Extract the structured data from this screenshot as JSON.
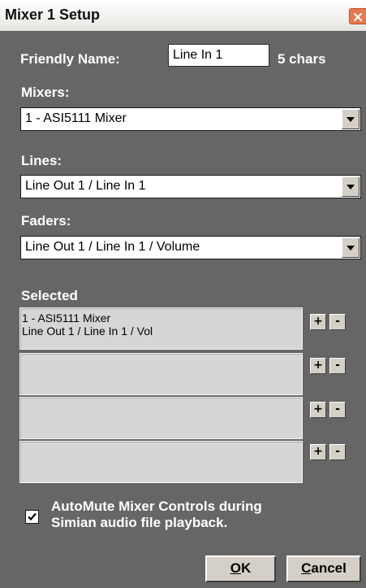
{
  "window": {
    "title": "Mixer 1 Setup",
    "close_icon": "close-icon"
  },
  "friendly_name": {
    "label": "Friendly Name:",
    "value": "Line In 1",
    "char_count": "5 chars"
  },
  "mixers": {
    "label": "Mixers:",
    "selected": "1 - ASI5111 Mixer"
  },
  "lines": {
    "label": "Lines:",
    "selected": "Line Out 1 / Line In 1"
  },
  "faders": {
    "label": "Faders:",
    "selected": "Line Out 1 / Line In 1 / Volume"
  },
  "selected": {
    "label": "Selected",
    "slots": [
      {
        "line1": "1 - ASI5111 Mixer",
        "line2": "Line Out 1 / Line In 1 / Vol",
        "plus": "+",
        "minus": "-"
      },
      {
        "line1": "",
        "line2": "",
        "plus": "+",
        "minus": "-"
      },
      {
        "line1": "",
        "line2": "",
        "plus": "+",
        "minus": "-"
      },
      {
        "line1": "",
        "line2": "",
        "plus": "+",
        "minus": "-"
      }
    ]
  },
  "automute": {
    "checked": true,
    "line1": "AutoMute Mixer Controls during",
    "line2": "Simian audio file playback."
  },
  "buttons": {
    "ok": {
      "mnemonic": "O",
      "rest": "K"
    },
    "cancel": {
      "mnemonic": "C",
      "rest": "ancel"
    }
  },
  "colors": {
    "panel_bg": "#666666",
    "close_button": "#e8784e"
  }
}
